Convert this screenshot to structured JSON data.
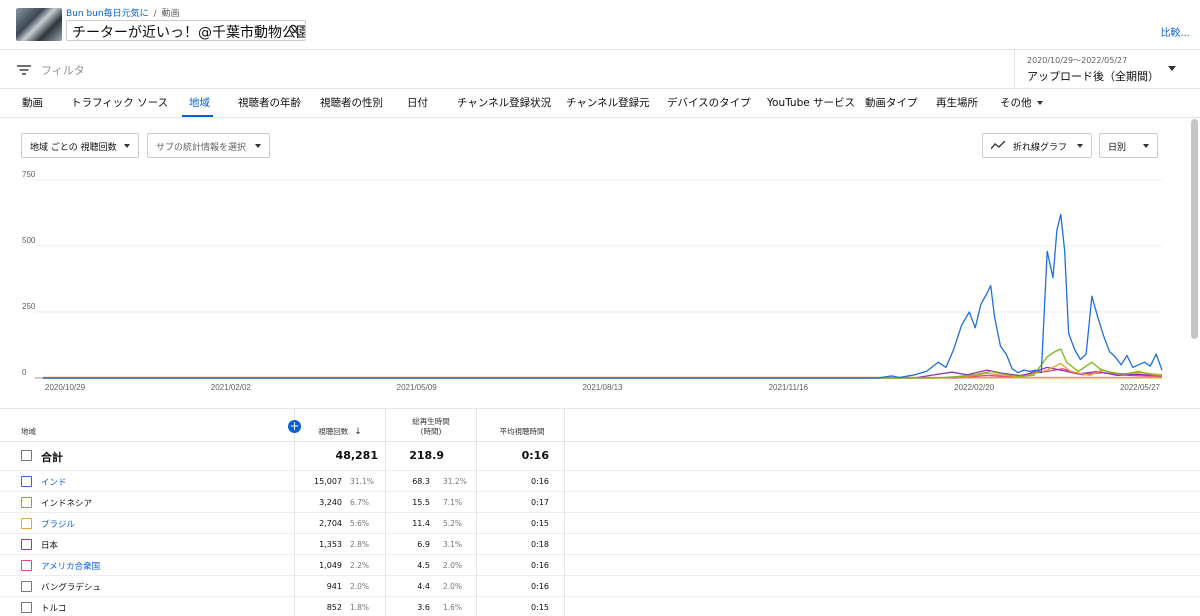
{
  "header": {
    "channel": "Bun bun毎日元気に",
    "breadcrumb_sep": "/",
    "section": "動画",
    "video_title": "チーターが近いっ！@千葉市動物公園",
    "compare": "比較..."
  },
  "filter": {
    "label": "フィルタ",
    "period_range": "2020/10/29〜2022/05/27",
    "period_value": "アップロード後（全期間）"
  },
  "tabs": [
    "動画",
    "トラフィック ソース",
    "地域",
    "視聴者の年齢",
    "視聴者の性別",
    "日付",
    "チャンネル登録状況",
    "チャンネル登録元",
    "デバイスのタイプ",
    "YouTube サービス",
    "動画タイプ",
    "再生場所",
    "その他"
  ],
  "active_tab": "地域",
  "controls": {
    "metric": "地域 ごとの 視聴回数",
    "secondary": "サブの統計情報を選択",
    "chart_type": "折れ線グラフ",
    "interval": "日別"
  },
  "chart_data": {
    "type": "line",
    "y_ticks": [
      0,
      250,
      500,
      750
    ],
    "ylim": [
      0,
      750
    ],
    "x_labels": [
      "2020/10/29",
      "2021/02/02",
      "2021/05/09",
      "2021/08/13",
      "2021/11/16",
      "2022/02/20",
      "2022/05/27"
    ],
    "x_range": [
      "2020-10-29",
      "2022-05-27"
    ],
    "grid": true,
    "series": [
      {
        "name": "インド",
        "color": "#1f6fd4",
        "points": [
          [
            "2020-10-29",
            0
          ],
          [
            "2022-01-01",
            0
          ],
          [
            "2022-01-08",
            8
          ],
          [
            "2022-01-12",
            2
          ],
          [
            "2022-01-20",
            12
          ],
          [
            "2022-01-26",
            25
          ],
          [
            "2022-02-01",
            60
          ],
          [
            "2022-02-05",
            40
          ],
          [
            "2022-02-09",
            110
          ],
          [
            "2022-02-13",
            200
          ],
          [
            "2022-02-17",
            250
          ],
          [
            "2022-02-20",
            190
          ],
          [
            "2022-02-23",
            280
          ],
          [
            "2022-02-26",
            320
          ],
          [
            "2022-02-28",
            350
          ],
          [
            "2022-03-02",
            230
          ],
          [
            "2022-03-05",
            120
          ],
          [
            "2022-03-08",
            90
          ],
          [
            "2022-03-11",
            35
          ],
          [
            "2022-03-14",
            20
          ],
          [
            "2022-03-17",
            30
          ],
          [
            "2022-03-20",
            25
          ],
          [
            "2022-03-23",
            30
          ],
          [
            "2022-03-26",
            20
          ],
          [
            "2022-03-29",
            480
          ],
          [
            "2022-04-01",
            380
          ],
          [
            "2022-04-03",
            560
          ],
          [
            "2022-04-05",
            620
          ],
          [
            "2022-04-07",
            480
          ],
          [
            "2022-04-09",
            170
          ],
          [
            "2022-04-12",
            110
          ],
          [
            "2022-04-15",
            70
          ],
          [
            "2022-04-18",
            90
          ],
          [
            "2022-04-21",
            310
          ],
          [
            "2022-04-24",
            230
          ],
          [
            "2022-04-27",
            160
          ],
          [
            "2022-04-30",
            100
          ],
          [
            "2022-05-03",
            80
          ],
          [
            "2022-05-06",
            50
          ],
          [
            "2022-05-09",
            85
          ],
          [
            "2022-05-12",
            40
          ],
          [
            "2022-05-15",
            50
          ],
          [
            "2022-05-18",
            60
          ],
          [
            "2022-05-21",
            45
          ],
          [
            "2022-05-24",
            90
          ],
          [
            "2022-05-27",
            30
          ]
        ]
      },
      {
        "name": "インドネシア",
        "color": "#7cb518",
        "points": [
          [
            "2020-10-29",
            0
          ],
          [
            "2022-02-01",
            0
          ],
          [
            "2022-02-10",
            5
          ],
          [
            "2022-02-20",
            12
          ],
          [
            "2022-02-28",
            25
          ],
          [
            "2022-03-06",
            15
          ],
          [
            "2022-03-14",
            6
          ],
          [
            "2022-03-22",
            10
          ],
          [
            "2022-03-29",
            80
          ],
          [
            "2022-04-02",
            100
          ],
          [
            "2022-04-05",
            110
          ],
          [
            "2022-04-08",
            60
          ],
          [
            "2022-04-14",
            25
          ],
          [
            "2022-04-21",
            60
          ],
          [
            "2022-04-25",
            35
          ],
          [
            "2022-05-01",
            20
          ],
          [
            "2022-05-08",
            15
          ],
          [
            "2022-05-15",
            25
          ],
          [
            "2022-05-22",
            12
          ],
          [
            "2022-05-27",
            8
          ]
        ]
      },
      {
        "name": "ブラジル",
        "color": "#f0a030",
        "points": [
          [
            "2020-10-29",
            0
          ],
          [
            "2022-02-01",
            0
          ],
          [
            "2022-02-15",
            4
          ],
          [
            "2022-02-26",
            18
          ],
          [
            "2022-03-06",
            10
          ],
          [
            "2022-03-16",
            4
          ],
          [
            "2022-03-29",
            30
          ],
          [
            "2022-04-05",
            55
          ],
          [
            "2022-04-10",
            25
          ],
          [
            "2022-04-20",
            10
          ],
          [
            "2022-04-26",
            30
          ],
          [
            "2022-05-05",
            15
          ],
          [
            "2022-05-16",
            20
          ],
          [
            "2022-05-27",
            12
          ]
        ]
      },
      {
        "name": "日本",
        "color": "#8e35b5",
        "points": [
          [
            "2020-10-29",
            0
          ],
          [
            "2022-01-20",
            0
          ],
          [
            "2022-01-28",
            10
          ],
          [
            "2022-02-08",
            22
          ],
          [
            "2022-02-16",
            12
          ],
          [
            "2022-02-26",
            30
          ],
          [
            "2022-03-06",
            18
          ],
          [
            "2022-03-16",
            8
          ],
          [
            "2022-03-29",
            40
          ],
          [
            "2022-04-05",
            30
          ],
          [
            "2022-04-14",
            15
          ],
          [
            "2022-04-24",
            25
          ],
          [
            "2022-05-04",
            10
          ],
          [
            "2022-05-14",
            14
          ],
          [
            "2022-05-27",
            8
          ]
        ]
      },
      {
        "name": "アメリカ合衆国",
        "color": "#e0457b",
        "points": [
          [
            "2020-10-29",
            0
          ],
          [
            "2022-02-10",
            0
          ],
          [
            "2022-02-26",
            10
          ],
          [
            "2022-03-10",
            5
          ],
          [
            "2022-03-29",
            25
          ],
          [
            "2022-04-06",
            35
          ],
          [
            "2022-04-16",
            12
          ],
          [
            "2022-04-26",
            20
          ],
          [
            "2022-05-10",
            10
          ],
          [
            "2022-05-27",
            6
          ]
        ]
      }
    ]
  },
  "table": {
    "col_region": "地域",
    "col_views": "視聴回数",
    "col_watch_time": "総再生時間\n(時間)",
    "col_avg_duration": "平均視聴時間",
    "total": {
      "label": "合計",
      "views": "48,281",
      "watch": "218.9",
      "avg": "0:16"
    },
    "rows": [
      {
        "name": "インド",
        "link": true,
        "color": "#1f6fd4",
        "views": "15,007",
        "views_pct": "31.1%",
        "watch": "68.3",
        "watch_pct": "31.2%",
        "avg": "0:16"
      },
      {
        "name": "インドネシア",
        "link": false,
        "color": "#7cb518",
        "views": "3,240",
        "views_pct": "6.7%",
        "watch": "15.5",
        "watch_pct": "7.1%",
        "avg": "0:17"
      },
      {
        "name": "ブラジル",
        "link": true,
        "color": "#f0a030",
        "views": "2,704",
        "views_pct": "5.6%",
        "watch": "11.4",
        "watch_pct": "5.2%",
        "avg": "0:15"
      },
      {
        "name": "日本",
        "link": false,
        "color": "#8e35b5",
        "views": "1,353",
        "views_pct": "2.8%",
        "watch": "6.9",
        "watch_pct": "3.1%",
        "avg": "0:18"
      },
      {
        "name": "アメリカ合衆国",
        "link": true,
        "color": "#e0457b",
        "views": "1,049",
        "views_pct": "2.2%",
        "watch": "4.5",
        "watch_pct": "2.0%",
        "avg": "0:16"
      },
      {
        "name": "バングラデシュ",
        "link": false,
        "color": "#777777",
        "views": "941",
        "views_pct": "2.0%",
        "watch": "4.4",
        "watch_pct": "2.0%",
        "avg": "0:16"
      },
      {
        "name": "トルコ",
        "link": false,
        "color": "#777777",
        "views": "852",
        "views_pct": "1.8%",
        "watch": "3.6",
        "watch_pct": "1.6%",
        "avg": "0:15"
      }
    ]
  }
}
